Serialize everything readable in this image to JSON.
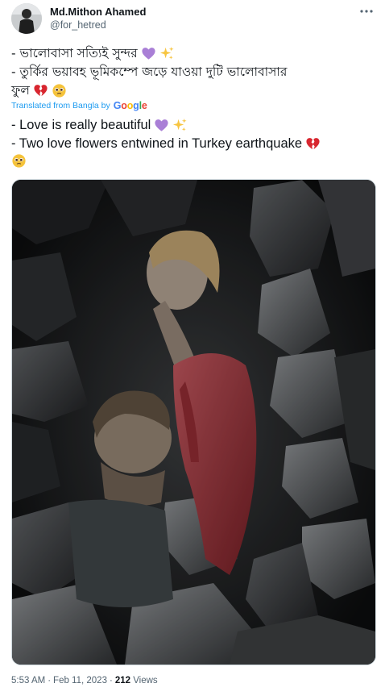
{
  "author": {
    "name": "Md.Mithon Ahamed",
    "handle": "@for_hetred"
  },
  "tweet": {
    "original_lines": [
      "- ভালোবাসা সত্যিই সুন্দর",
      "- তুর্কির ভয়াবহ ভূমিকম্পে জড়ে যাওয়া দুটি ভালোবাসার",
      "ফুল"
    ],
    "translated_from_label": "Translated from Bangla by",
    "translation_provider": "Google",
    "translated_lines": [
      "- Love is really beautiful",
      "- Two love flowers entwined in Turkey earthquake"
    ]
  },
  "media": {
    "icon": "photo-of-two-people-in-rubble"
  },
  "meta": {
    "time": "5:53 AM",
    "separator": "·",
    "date": "Feb 11, 2023",
    "views_count": "212",
    "views_label": "Views"
  },
  "icons": {
    "more": "more-dots-icon",
    "purple_heart": "purple-heart-emoji",
    "sparkles": "sparkles-emoji",
    "broken_heart": "broken-heart-emoji",
    "face": "pleading-face-emoji"
  },
  "colors": {
    "link_blue": "#1d9bf0",
    "text_primary": "#0f1419",
    "text_secondary": "#536471",
    "purple_heart": "#a97fd6",
    "sparkle": "#f7c542",
    "broken_heart": "#d8262f",
    "face": "#f5c33b"
  }
}
